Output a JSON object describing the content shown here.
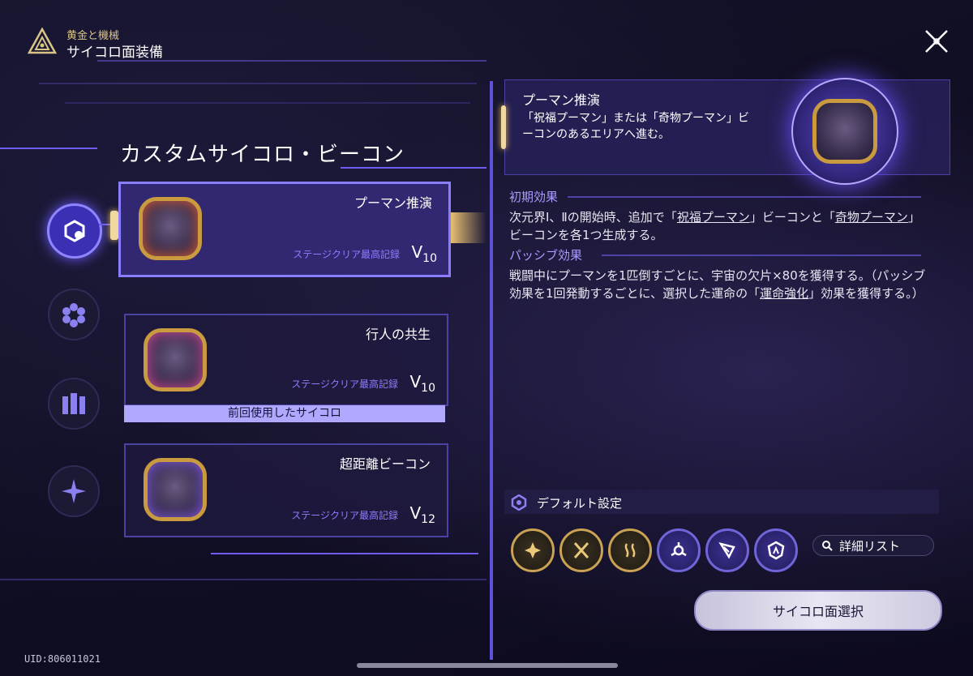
{
  "header": {
    "subtitle": "黄金と機械",
    "title": "サイコロ面装備"
  },
  "section_title": "カスタムサイコロ・ビーコン",
  "sidebar": {
    "items": [
      {
        "icon": "dice-face-icon",
        "active": true
      },
      {
        "icon": "hexagon-cluster-icon",
        "active": false
      },
      {
        "icon": "pillars-icon",
        "active": false
      },
      {
        "icon": "star-burst-icon",
        "active": false
      }
    ]
  },
  "cards": [
    {
      "name": "プーマン推演",
      "record_label": "ステージクリア最高記録",
      "rank": "V",
      "rank_num": "10",
      "active": true,
      "core_color": "#e0603a"
    },
    {
      "name": "行人の共生",
      "record_label": "ステージクリア最高記録",
      "rank": "V",
      "rank_num": "10",
      "active": false,
      "core_color": "#e050a0"
    },
    {
      "name": "超距離ビーコン",
      "record_label": "ステージクリア最高記録",
      "rank": "V",
      "rank_num": "12",
      "active": false,
      "core_color": "#8a60f0"
    }
  ],
  "last_used_label": "前回使用したサイコロ",
  "detail": {
    "name": "プーマン推演",
    "desc": "「祝福プーマン」または「奇物プーマン」ビーコンのあるエリアへ進む。",
    "initial_label": "初期効果",
    "initial_pre": "次元界Ⅰ、Ⅱの開始時、追加で「",
    "initial_u1": "祝福プーマン",
    "initial_mid": "」ビーコンと「",
    "initial_u2": "奇物プーマン",
    "initial_post": "」ビーコンを各1つ生成する。",
    "passive_label": "パッシブ効果",
    "passive_pre": "戦闘中にプーマンを1匹倒すごとに、宇宙の欠片×80を獲得する。（パッシブ効果を1回発動するごとに、選択した運命の「",
    "passive_u": "運命強化",
    "passive_post": "」効果を獲得する。）"
  },
  "default": {
    "title": "デフォルト設定",
    "paths": [
      {
        "icon": "nihility-path-icon",
        "tone": "gold"
      },
      {
        "icon": "destruction-path-icon",
        "tone": "gold"
      },
      {
        "icon": "abundance-path-icon",
        "tone": "gold"
      },
      {
        "icon": "harmony-path-icon",
        "tone": "blue"
      },
      {
        "icon": "hunt-path-icon",
        "tone": "blue"
      },
      {
        "icon": "preservation-path-icon",
        "tone": "blue"
      }
    ],
    "detail_list_label": "詳細リスト"
  },
  "select_button": "サイコロ面選択",
  "uid": "UID:806011021",
  "colors": {
    "accent": "#6d5cf0",
    "gold": "#c9a253",
    "highlight_text": "#a99cff"
  }
}
